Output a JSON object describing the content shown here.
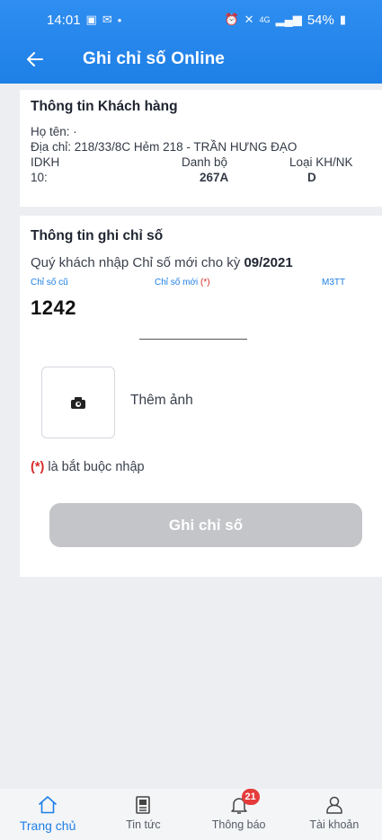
{
  "status_bar": {
    "time": "14:01",
    "battery": "54%",
    "network": "4G"
  },
  "header": {
    "title": "Ghi chỉ số Online"
  },
  "customer_info": {
    "title": "Thông tin Khách hàng",
    "name_label": "Họ tên:",
    "name_value": "·",
    "address_label": "Địa chỉ:",
    "address_value": "218/33/8C Hẻm 218 - TRẦN HƯNG ĐẠO",
    "id_label": "IDKH",
    "id_value": "10:",
    "book_label": "Danh bộ",
    "book_value": "267A",
    "type_label": "Loại KH/NK",
    "type_value": "D"
  },
  "reading_info": {
    "title": "Thông tin ghi chỉ số",
    "prompt_prefix": "Quý khách nhập Chỉ số mới cho kỳ",
    "period": "09/2021",
    "old_label": "Chỉ số cũ",
    "new_label": "Chỉ số mới",
    "required_marker": "(*)",
    "unit_label": "M3TT",
    "old_value": "1242",
    "new_value": "",
    "add_photo_label": "Thêm ảnh",
    "required_note": "là bắt buộc nhập",
    "submit_label": "Ghi chỉ số"
  },
  "bottom_nav": {
    "items": [
      {
        "label": "Trang chủ",
        "icon": "home-icon",
        "active": true
      },
      {
        "label": "Tin tức",
        "icon": "news-icon",
        "active": false
      },
      {
        "label": "Thông báo",
        "icon": "bell-icon",
        "active": false,
        "badge": "21"
      },
      {
        "label": "Tài khoản",
        "icon": "user-icon",
        "active": false
      }
    ]
  },
  "colors": {
    "primary": "#1e7fe6",
    "required": "#d62a2a",
    "disabled_button": "#c4c5c8",
    "badge": "#e53b3b"
  }
}
